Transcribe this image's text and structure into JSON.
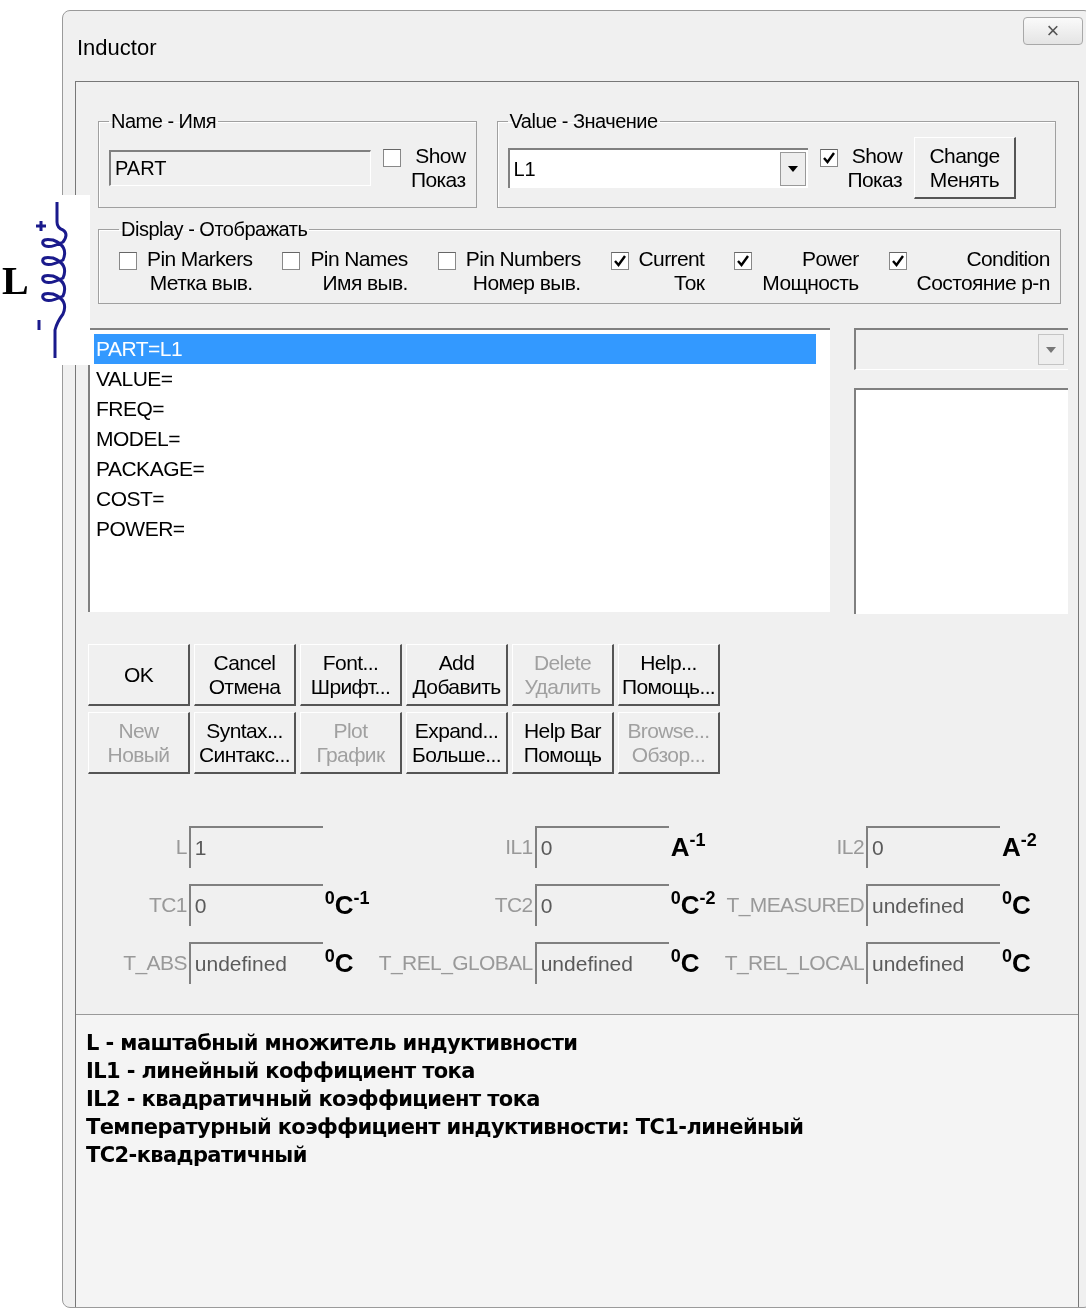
{
  "window": {
    "title": "Inductor",
    "close": "×"
  },
  "symbol": {
    "label": "L"
  },
  "name_group": {
    "legend": "Name - Имя",
    "value": "PART",
    "show": {
      "label": "Show",
      "sub": "Показ",
      "checked": false
    }
  },
  "value_group": {
    "legend": "Value - Значение",
    "value": "L1",
    "show": {
      "label": "Show",
      "sub": "Показ",
      "checked": true
    },
    "change": {
      "label": "Change",
      "sub": "Менять"
    }
  },
  "display_group": {
    "legend": "Display - Отображать",
    "options": [
      {
        "label": "Pin Markers",
        "sub": "Метка выв.",
        "checked": false
      },
      {
        "label": "Pin Names",
        "sub": "Имя выв.",
        "checked": false
      },
      {
        "label": "Pin Numbers",
        "sub": "Номер выв.",
        "checked": false
      },
      {
        "label": "Current",
        "sub": "Ток",
        "checked": true
      },
      {
        "label": "Power",
        "sub": "Мощность",
        "checked": true
      },
      {
        "label": "Condition",
        "sub": "Состояние p-n",
        "checked": true
      }
    ]
  },
  "attributes": [
    {
      "text": "PART=L1",
      "selected": true
    },
    {
      "text": "VALUE=",
      "selected": false
    },
    {
      "text": "FREQ=",
      "selected": false
    },
    {
      "text": "MODEL=",
      "selected": false
    },
    {
      "text": "PACKAGE=",
      "selected": false
    },
    {
      "text": "COST=",
      "selected": false
    },
    {
      "text": "POWER=",
      "selected": false
    }
  ],
  "button_rows": [
    [
      {
        "label": "OK",
        "disabled": false
      },
      {
        "label": "Cancel",
        "sub": "Отмена",
        "disabled": false
      },
      {
        "label": "Font...",
        "sub": "Шрифт...",
        "disabled": false
      },
      {
        "label": "Add",
        "sub": "Добавить",
        "disabled": false
      },
      {
        "label": "Delete",
        "sub": "Удалить",
        "disabled": true
      },
      {
        "label": "Help...",
        "sub": "Помощь...",
        "disabled": false
      }
    ],
    [
      {
        "label": "New",
        "sub": "Новый",
        "disabled": true
      },
      {
        "label": "Syntax...",
        "sub": "Синтакс...",
        "disabled": false
      },
      {
        "label": "Plot",
        "sub": "График",
        "disabled": true
      },
      {
        "label": "Expand...",
        "sub": "Больше...",
        "disabled": false
      },
      {
        "label": "Help Bar",
        "sub": "Помощь",
        "disabled": false
      },
      {
        "label": "Browse...",
        "sub": "Обзор...",
        "disabled": true
      }
    ]
  ],
  "parameters": [
    [
      {
        "label": "L",
        "value": "1"
      },
      {
        "label": "IL1",
        "value": "0",
        "unit": "A$^{-1}$"
      },
      {
        "label": "IL2",
        "value": "0",
        "unit": "A$^{-2}$"
      }
    ],
    [
      {
        "label": "TC1",
        "value": "0",
        "unit": "$^{0}$C$^{-1}$"
      },
      {
        "label": "TC2",
        "value": "0",
        "unit": "$^{0}$C$^{-2}$"
      },
      {
        "label": "T_MEASURED",
        "value": "undefined",
        "unit": "$^{0}$C"
      }
    ],
    [
      {
        "label": "T_ABS",
        "value": "undefined",
        "unit": "$^{0}$C"
      },
      {
        "label": "T_REL_GLOBAL",
        "value": "undefined",
        "unit": "$^{0}$C"
      },
      {
        "label": "T_REL_LOCAL",
        "value": "undefined",
        "unit": "$^{0}$C"
      }
    ]
  ],
  "help_text": [
    "L - маштабный множитель индуктивности",
    "IL1 - линейный коффициент тока",
    "IL2 - квадратичный коэффициент тока",
    "Температурный коэффициент индуктивности: TC1-линейный",
    "TC2-квадратичный"
  ]
}
